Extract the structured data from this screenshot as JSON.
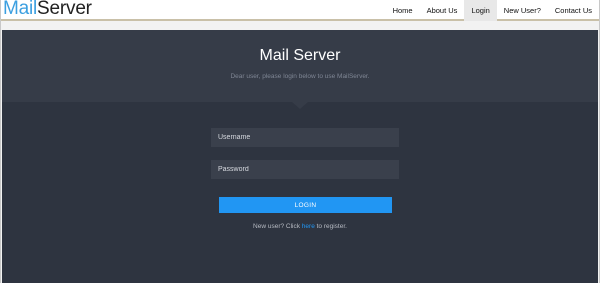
{
  "brand": {
    "part1": "Mail",
    "part2": "Server"
  },
  "nav": {
    "items": [
      {
        "label": "Home"
      },
      {
        "label": "About Us"
      },
      {
        "label": "Login",
        "active": true
      },
      {
        "label": "New User?"
      },
      {
        "label": "Contact Us"
      }
    ]
  },
  "hero": {
    "title": "Mail Server",
    "subtitle": "Dear user, please login below to use MailServer."
  },
  "form": {
    "username_placeholder": "Username",
    "password_placeholder": "Password",
    "login_label": "LOGIN"
  },
  "register": {
    "prefix": "New user? Click ",
    "link": "here",
    "suffix": " to register."
  },
  "colors": {
    "brand_accent": "#3b9fe0",
    "button": "#2196f3",
    "background": "#2e3440"
  }
}
